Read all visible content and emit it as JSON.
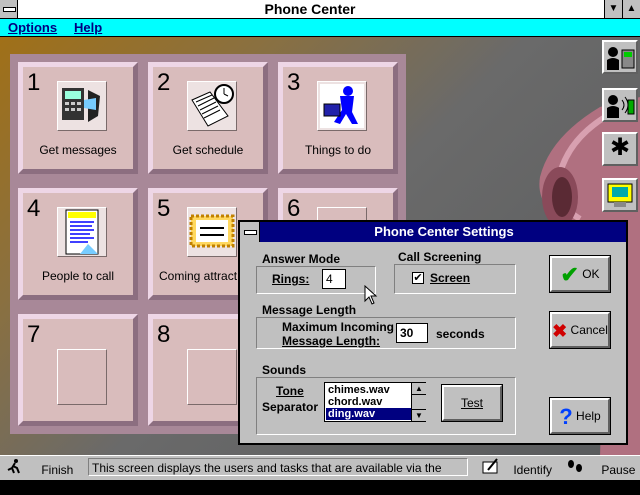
{
  "app": {
    "title": "Phone Center"
  },
  "titlebar": {
    "scroll_down_arrow": "▼",
    "scroll_up_arrow": "▲"
  },
  "menu": {
    "options": "Options",
    "help": "Help"
  },
  "tiles": [
    {
      "num": "1",
      "label": "Get messages",
      "icon": "phone-message-icon"
    },
    {
      "num": "2",
      "label": "Get schedule",
      "icon": "schedule-clock-icon"
    },
    {
      "num": "3",
      "label": "Things to do",
      "icon": "briefcase-person-icon"
    },
    {
      "num": "4",
      "label": "People to call",
      "icon": "call-back-list-icon"
    },
    {
      "num": "5",
      "label": "Coming attract",
      "icon": "coming-soon-sign-icon"
    },
    {
      "num": "6",
      "label": "",
      "icon": ""
    },
    {
      "num": "7",
      "label": "",
      "icon": ""
    },
    {
      "num": "8",
      "label": "",
      "icon": ""
    }
  ],
  "toolbar": {
    "screen_glyph": "✱"
  },
  "statusbar": {
    "finish": "Finish",
    "message": "This screen displays the users and tasks that are available via the telephone.",
    "identify": "Identify",
    "pause": "Pause"
  },
  "dialog": {
    "title": "Phone Center Settings",
    "answer_mode": {
      "heading": "Answer Mode",
      "rings_label": "Rings:",
      "rings_value": "4"
    },
    "call_screening": {
      "heading": "Call Screening",
      "screen_label": "Screen",
      "checked": true,
      "check_mark": "✔"
    },
    "message_length": {
      "heading": "Message Length",
      "label_line1": "Maximum Incoming",
      "label_line2": "Message Length:",
      "value": "30",
      "unit": "seconds"
    },
    "sounds": {
      "heading": "Sounds",
      "tone_label_1": "Tone",
      "tone_label_2": "Separator",
      "options": [
        "chimes.wav",
        "chord.wav",
        "ding.wav"
      ],
      "selected_index": 2,
      "test_button": "Test"
    },
    "buttons": {
      "ok": "OK",
      "cancel": "Cancel",
      "help": "Help"
    },
    "glyphs": {
      "ok": "✔",
      "cancel": "✖",
      "help": "?"
    }
  },
  "colors": {
    "title_bg": "#000080",
    "menu_bg": "#00ffff",
    "tile_bg": "#d9bcbc"
  }
}
